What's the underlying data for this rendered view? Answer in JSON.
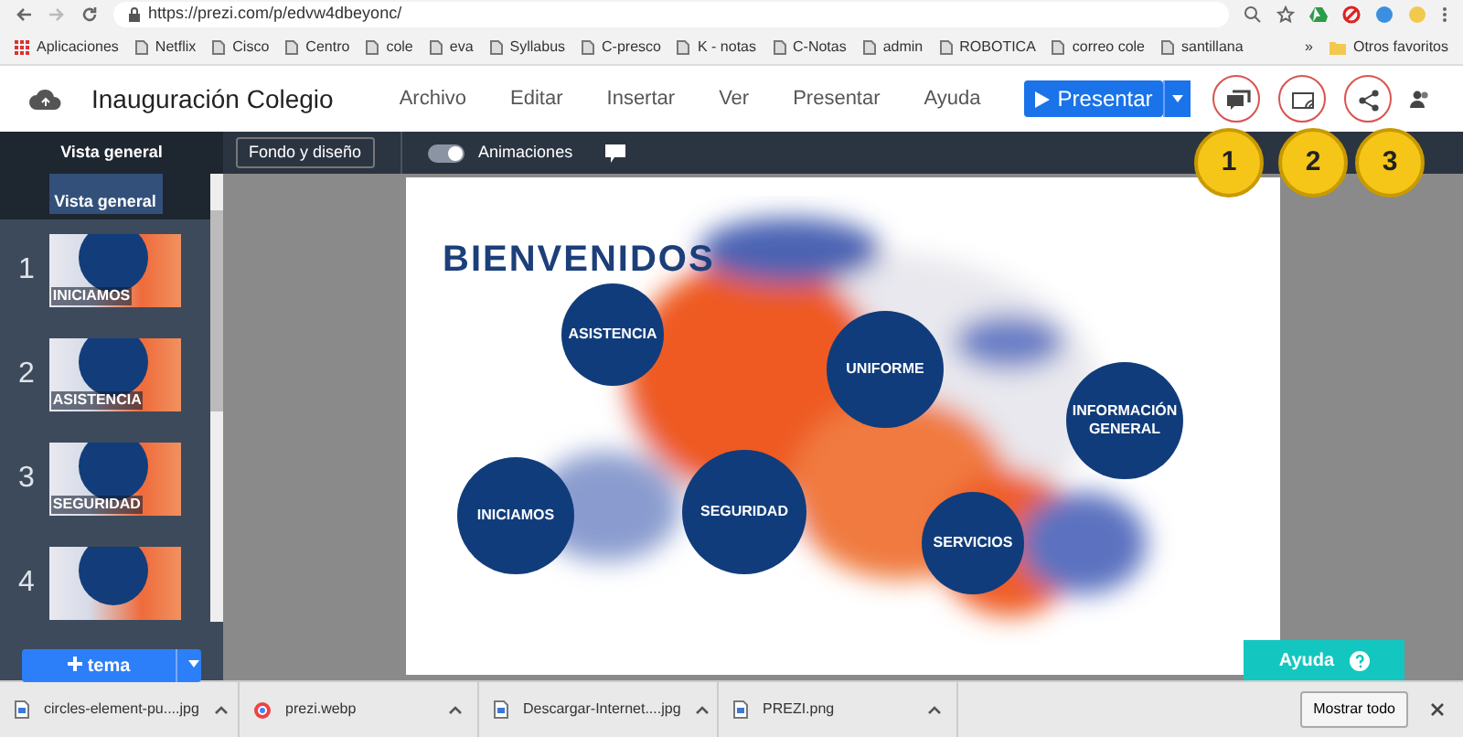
{
  "browser": {
    "url": "https://prezi.com/p/edvw4dbeyonc/",
    "apps_label": "Aplicaciones",
    "bookmarks": [
      "Netflix",
      "Cisco",
      "Centro",
      "cole",
      "eva",
      "Syllabus",
      "C-presco",
      "K - notas",
      "C-Notas",
      "admin",
      "ROBOTICA",
      "correo cole",
      "santillana"
    ],
    "more_label": "»",
    "other_bookmarks": "Otros favoritos"
  },
  "header": {
    "title": "Inauguración Colegio",
    "menu": [
      "Archivo",
      "Editar",
      "Insertar",
      "Ver",
      "Presentar",
      "Ayuda"
    ],
    "present_button": "Presentar"
  },
  "annotations": [
    "1",
    "2",
    "3"
  ],
  "toolbar": {
    "tab": "Vista general",
    "design_button": "Fondo y diseño",
    "toggle": {
      "label": "Animaciones",
      "on": true
    }
  },
  "sidebar": {
    "overview_label": "Vista general",
    "slides": [
      {
        "number": "1",
        "title": "INICIAMOS"
      },
      {
        "number": "2",
        "title": "ASISTENCIA"
      },
      {
        "number": "3",
        "title": "SEGURIDAD"
      },
      {
        "number": "4"
      }
    ],
    "add_button": "tema"
  },
  "slide": {
    "title": "BIENVENIDOS",
    "topics": [
      "ASISTENCIA",
      "UNIFORME",
      "INFORMACIÓN GENERAL",
      "INICIAMOS",
      "SEGURIDAD",
      "SERVICIOS"
    ]
  },
  "help_button": "Ayuda",
  "downloads": {
    "files": [
      {
        "name": "circles-element-pu....jpg",
        "kind": "image"
      },
      {
        "name": "prezi.webp",
        "kind": "web"
      },
      {
        "name": "Descargar-Internet....jpg",
        "kind": "image"
      },
      {
        "name": "PREZI.png",
        "kind": "image"
      }
    ],
    "show_all": "Mostrar todo"
  }
}
